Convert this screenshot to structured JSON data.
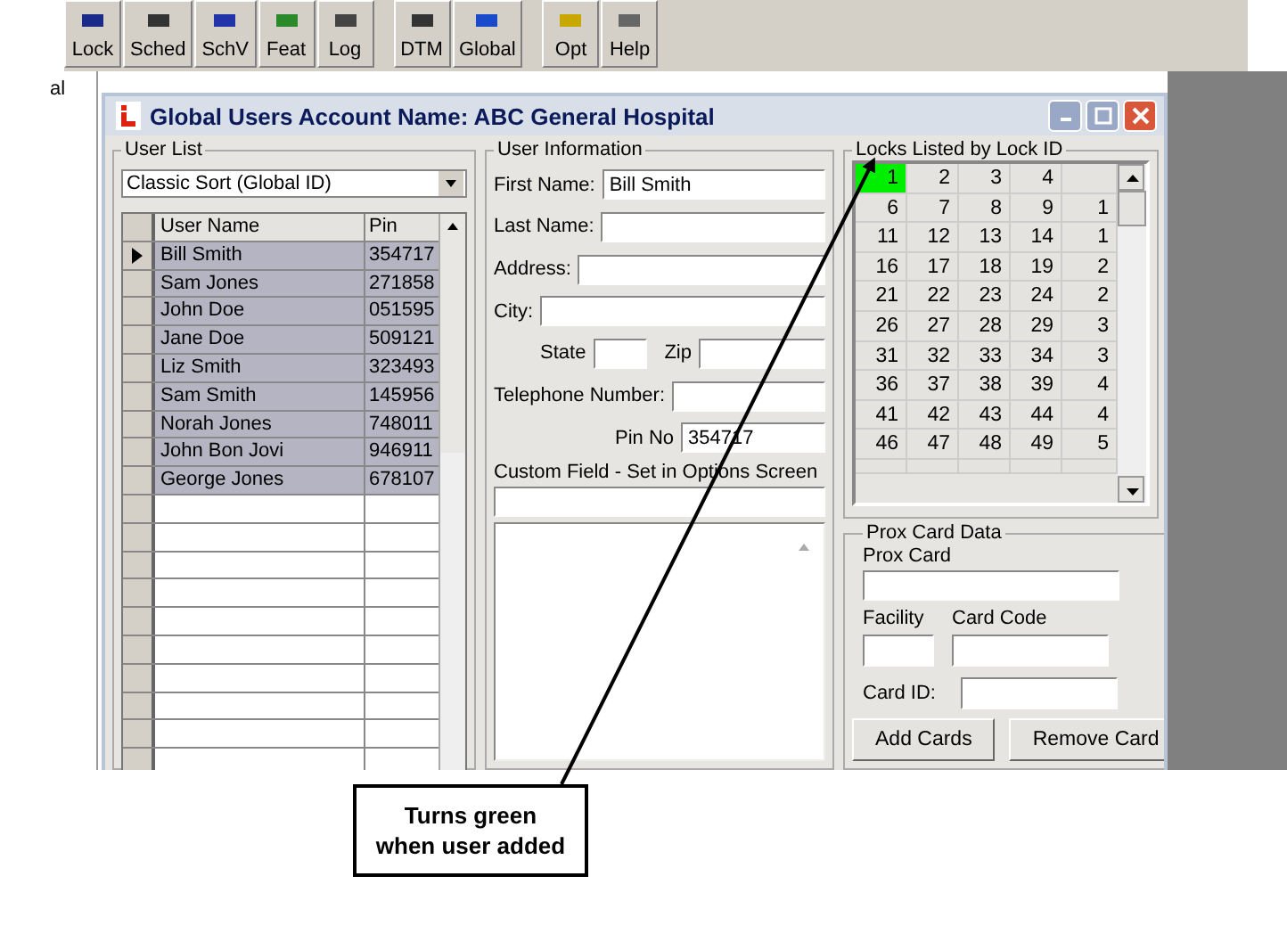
{
  "toolbar": [
    {
      "label": "Lock"
    },
    {
      "label": "Sched"
    },
    {
      "label": "SchV"
    },
    {
      "label": "Feat"
    },
    {
      "label": "Log"
    },
    {
      "label": "DTM"
    },
    {
      "label": "Global"
    },
    {
      "label": "Opt"
    },
    {
      "label": "Help"
    }
  ],
  "side_text": "al",
  "window": {
    "title": "Global Users Account Name: ABC General Hospital"
  },
  "user_list": {
    "title": "User List",
    "sort": "Classic Sort (Global ID)",
    "columns": [
      "User Name",
      "Pin"
    ],
    "rows": [
      {
        "name": "Bill Smith",
        "pin": "354717",
        "current": true,
        "selected": true
      },
      {
        "name": "Sam Jones",
        "pin": "271858",
        "current": false,
        "selected": true
      },
      {
        "name": "John Doe",
        "pin": "051595",
        "current": false,
        "selected": true
      },
      {
        "name": "Jane Doe",
        "pin": "509121",
        "current": false,
        "selected": true
      },
      {
        "name": "Liz Smith",
        "pin": "323493",
        "current": false,
        "selected": true
      },
      {
        "name": "Sam Smith",
        "pin": "145956",
        "current": false,
        "selected": true
      },
      {
        "name": "Norah Jones",
        "pin": "748011",
        "current": false,
        "selected": true
      },
      {
        "name": "John Bon Jovi",
        "pin": "946911",
        "current": false,
        "selected": true
      },
      {
        "name": "George Jones",
        "pin": "678107",
        "current": false,
        "selected": true
      }
    ]
  },
  "user_info": {
    "title": "User Information",
    "first_name": {
      "label": "First Name:",
      "value": "Bill Smith"
    },
    "last_name": {
      "label": "Last Name:"
    },
    "address": {
      "label": "Address:"
    },
    "city": {
      "label": "City:"
    },
    "state": {
      "label": "State"
    },
    "zip": {
      "label": "Zip"
    },
    "telephone": {
      "label": "Telephone Number:"
    },
    "pin": {
      "label": "Pin No",
      "value": "354717"
    },
    "custom": {
      "label": "Custom Field - Set in Options Screen"
    }
  },
  "locks": {
    "title": "Locks Listed by Lock ID",
    "rows": [
      [
        {
          "n": "1",
          "added": true
        },
        {
          "n": "2",
          "added": false
        },
        {
          "n": "3",
          "added": false
        },
        {
          "n": "4",
          "added": false
        },
        {
          "added": false
        }
      ],
      [
        {
          "n": "6",
          "added": false
        },
        {
          "n": "7",
          "added": false
        },
        {
          "n": "8",
          "added": false
        },
        {
          "n": "9",
          "added": false
        },
        {
          "n": "1",
          "added": false
        }
      ],
      [
        {
          "n": "11",
          "added": false
        },
        {
          "n": "12",
          "added": false
        },
        {
          "n": "13",
          "added": false
        },
        {
          "n": "14",
          "added": false
        },
        {
          "n": "1",
          "added": false
        }
      ],
      [
        {
          "n": "16",
          "added": false
        },
        {
          "n": "17",
          "added": false
        },
        {
          "n": "18",
          "added": false
        },
        {
          "n": "19",
          "added": false
        },
        {
          "n": "2",
          "added": false
        }
      ],
      [
        {
          "n": "21",
          "added": false
        },
        {
          "n": "22",
          "added": false
        },
        {
          "n": "23",
          "added": false
        },
        {
          "n": "24",
          "added": false
        },
        {
          "n": "2",
          "added": false
        }
      ],
      [
        {
          "n": "26",
          "added": false
        },
        {
          "n": "27",
          "added": false
        },
        {
          "n": "28",
          "added": false
        },
        {
          "n": "29",
          "added": false
        },
        {
          "n": "3",
          "added": false
        }
      ],
      [
        {
          "n": "31",
          "added": false
        },
        {
          "n": "32",
          "added": false
        },
        {
          "n": "33",
          "added": false
        },
        {
          "n": "34",
          "added": false
        },
        {
          "n": "3",
          "added": false
        }
      ],
      [
        {
          "n": "36",
          "added": false
        },
        {
          "n": "37",
          "added": false
        },
        {
          "n": "38",
          "added": false
        },
        {
          "n": "39",
          "added": false
        },
        {
          "n": "4",
          "added": false
        }
      ],
      [
        {
          "n": "41",
          "added": false
        },
        {
          "n": "42",
          "added": false
        },
        {
          "n": "43",
          "added": false
        },
        {
          "n": "44",
          "added": false
        },
        {
          "n": "4",
          "added": false
        }
      ],
      [
        {
          "n": "46",
          "added": false
        },
        {
          "n": "47",
          "added": false
        },
        {
          "n": "48",
          "added": false
        },
        {
          "n": "49",
          "added": false
        },
        {
          "n": "5",
          "added": false
        }
      ]
    ]
  },
  "prox": {
    "title": "Prox Card Data",
    "prox_card": {
      "label": "Prox Card"
    },
    "facility": {
      "label": "Facility"
    },
    "card_code": {
      "label": "Card Code"
    },
    "card_id": {
      "label": "Card ID:"
    },
    "buttons": [
      "Add Cards",
      "Remove Card"
    ]
  },
  "callout": {
    "text": "Turns green\nwhen user added"
  }
}
